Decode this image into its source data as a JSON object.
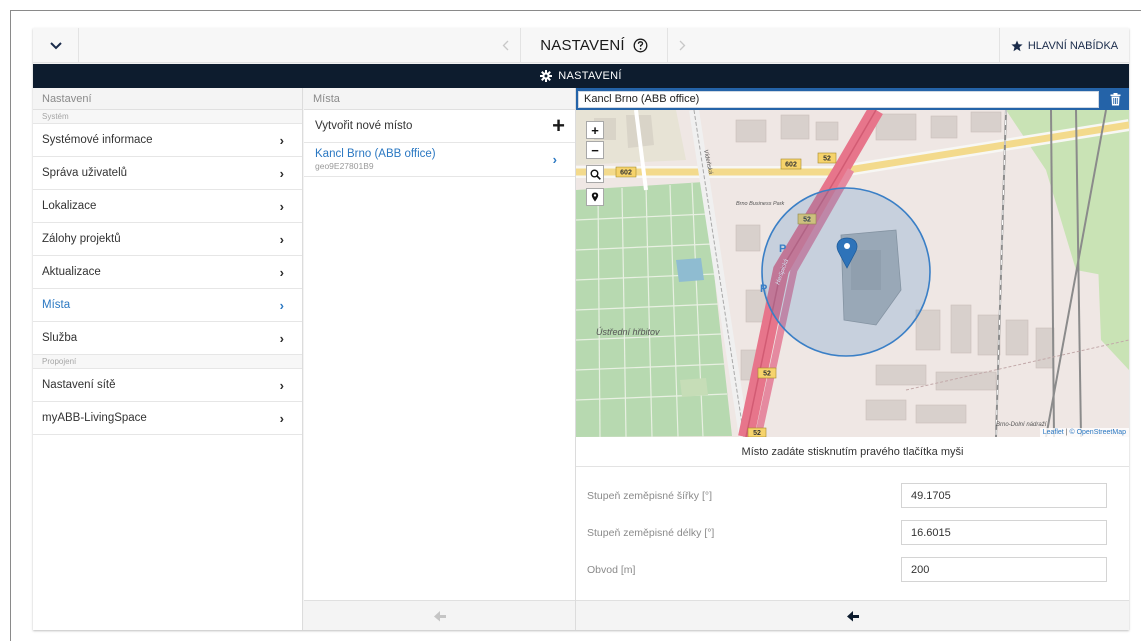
{
  "topbar": {
    "title": "NASTAVENÍ",
    "main_menu_label": "HLAVNÍ NABÍDKA"
  },
  "header": {
    "title": "NASTAVENÍ"
  },
  "left_panel": {
    "heading": "Nastavení",
    "sections": [
      {
        "label": "Systém",
        "items": [
          {
            "label": "Systémové informace"
          },
          {
            "label": "Správa uživatelů"
          },
          {
            "label": "Lokalizace"
          },
          {
            "label": "Zálohy projektů"
          },
          {
            "label": "Aktualizace"
          },
          {
            "label": "Místa",
            "active": true
          },
          {
            "label": "Služba"
          }
        ]
      },
      {
        "label": "Propojení",
        "items": [
          {
            "label": "Nastavení sítě"
          },
          {
            "label": "myABB-LivingSpace"
          }
        ]
      }
    ]
  },
  "middle_panel": {
    "heading": "Místa",
    "create_label": "Vytvořit nové místo",
    "places": [
      {
        "name": "Kancl Brno (ABB office)",
        "id": "geo9E27801B9"
      }
    ]
  },
  "right_panel": {
    "place_name": "Kancl Brno (ABB office)",
    "map": {
      "zoom_in": "+",
      "zoom_out": "−",
      "labels": {
        "cemetery": "Ústřední hřbitov",
        "road_52": "52",
        "road_602": "602",
        "station": "Brno-Dolní nádraží",
        "hall": "Brno Business Park",
        "street_1": "Vídeňská",
        "street_2": "Heršpická",
        "parking": "P"
      },
      "attribution_leaflet": "Leaflet",
      "attribution_osm": "© OpenStreetMap"
    },
    "hint": "Místo zadáte stisknutím pravého tlačítka myši",
    "fields": {
      "lat_label": "Stupeň zeměpisné šířky [°]",
      "lat_value": "49.1705",
      "lon_label": "Stupeň zeměpisné délky [°]",
      "lon_value": "16.6015",
      "radius_label": "Obvod [m]",
      "radius_value": "200"
    }
  },
  "colors": {
    "accent": "#2b78c2",
    "header_dark": "#0d1c2e",
    "search_bar": "#2463a8",
    "geofence": "#3a7fc6"
  }
}
